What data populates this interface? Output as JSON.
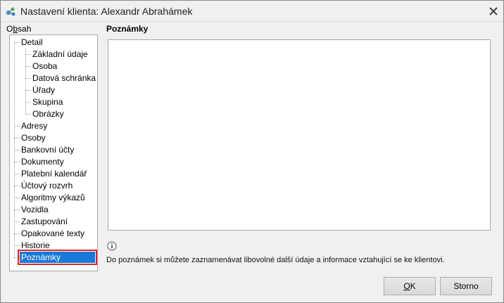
{
  "window": {
    "title": "Nastavení klienta:  Alexandr Abrahámek"
  },
  "sidebar": {
    "label_mnemonic": "b",
    "label_before": "O",
    "label_after": "sah",
    "items": [
      {
        "label": "Detail",
        "level": 0
      },
      {
        "label": "Základní údaje",
        "level": 1
      },
      {
        "label": "Osoba",
        "level": 1
      },
      {
        "label": "Datová schránka",
        "level": 1
      },
      {
        "label": "Úřady",
        "level": 1
      },
      {
        "label": "Skupina",
        "level": 1
      },
      {
        "label": "Obrázky",
        "level": 1
      },
      {
        "label": "Adresy",
        "level": 0
      },
      {
        "label": "Osoby",
        "level": 0
      },
      {
        "label": "Bankovní účty",
        "level": 0
      },
      {
        "label": "Dokumenty",
        "level": 0
      },
      {
        "label": "Platební kalendář",
        "level": 0
      },
      {
        "label": "Účtový rozvrh",
        "level": 0
      },
      {
        "label": "Algoritmy výkazů",
        "level": 0
      },
      {
        "label": "Vozidla",
        "level": 0
      },
      {
        "label": "Zastupování",
        "level": 0
      },
      {
        "label": "Opakované texty",
        "level": 0
      },
      {
        "label": "Historie",
        "level": 0
      },
      {
        "label": "Poznámky",
        "level": 0,
        "selected": true
      }
    ]
  },
  "main": {
    "section_title": "Poznámky",
    "notes_value": "",
    "info_text": "Do poznámek si můžete zaznamenávat libovolné další údaje a informace vztahující se ke klientovi."
  },
  "buttons": {
    "ok_mnemonic": "O",
    "ok_rest": "K",
    "storno_label": "Storno"
  },
  "colors": {
    "selection": "#1a78d8",
    "selection_outline": "#d42a2a"
  }
}
